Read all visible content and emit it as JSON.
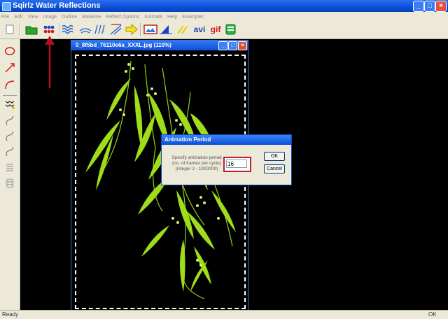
{
  "window": {
    "title": "Sqirlz Water Reflections"
  },
  "menu": [
    "File",
    "Edit",
    "View",
    "Image",
    "Outline",
    "Baseline",
    "Reflect Options",
    "Animate",
    "Help",
    "Examples"
  ],
  "toolbar": {
    "avi_label": "avi",
    "gif_label": "gif"
  },
  "image_window": {
    "title": "0_8f5bd_76110e6a_XXXL.jpg  (110%)"
  },
  "dialog": {
    "title": "Animation Period",
    "prompt_line1": "Specify animation period",
    "prompt_line2": "(no. of frames per cycle)",
    "prompt_line3": "(integer 2 - 1000000)",
    "value": "16",
    "ok_label": "OK",
    "cancel_label": "Cancel"
  },
  "status": {
    "left": "Ready",
    "right": "OK"
  },
  "colors": {
    "titlebar": "#0a4fd8",
    "chrome": "#ece9d8",
    "highlight_box": "#c0202a",
    "arrow": "#b01020",
    "plant": "#9fdc1a"
  }
}
